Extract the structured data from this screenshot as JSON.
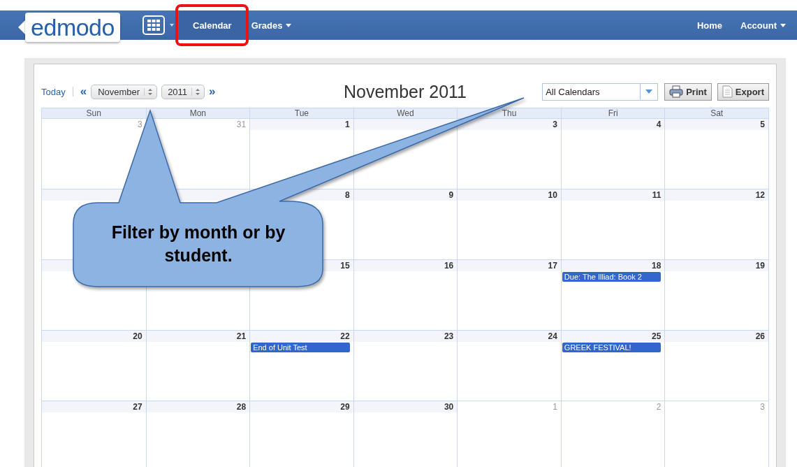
{
  "nav": {
    "logo": "edmodo",
    "items": [
      {
        "label": "Calendar",
        "selected": true,
        "has_menu": false,
        "highlighted": true
      },
      {
        "label": "Grades",
        "selected": false,
        "has_menu": true,
        "highlighted": false
      }
    ],
    "right_items": [
      {
        "label": "Home",
        "has_menu": false
      },
      {
        "label": "Account",
        "has_menu": true
      }
    ]
  },
  "toolbar": {
    "today": "Today",
    "prev": "«",
    "month": "November",
    "year": "2011",
    "next": "»",
    "title": "November 2011",
    "calendar_filter": "All Calendars",
    "buttons": [
      {
        "label": "Print",
        "kind": "print"
      },
      {
        "label": "Export",
        "kind": "export"
      }
    ]
  },
  "weekdays": [
    "Sun",
    "Mon",
    "Tue",
    "Wed",
    "Thu",
    "Fri",
    "Sat"
  ],
  "weeks": [
    [
      {
        "kind": "day",
        "number": "3",
        "current_month": false
      },
      {
        "kind": "day",
        "number": "31",
        "current_month": false
      },
      {
        "kind": "day",
        "number": "1",
        "current_month": true
      },
      {
        "kind": "day",
        "current_month": true
      },
      {
        "kind": "day",
        "number": "3",
        "current_month": true
      },
      {
        "kind": "day",
        "number": "4",
        "current_month": true
      },
      {
        "kind": "day",
        "number": "5",
        "current_month": true
      }
    ],
    [
      {
        "kind": "day",
        "current_month": true
      },
      {
        "kind": "day",
        "current_month": true
      },
      {
        "kind": "day",
        "number": "8",
        "current_month": true
      },
      {
        "kind": "day",
        "number": "9",
        "current_month": true
      },
      {
        "kind": "day",
        "number": "10",
        "current_month": true
      },
      {
        "kind": "day",
        "number": "11",
        "current_month": true
      },
      {
        "kind": "day",
        "number": "12",
        "current_month": true
      }
    ],
    [
      {
        "kind": "day",
        "current_month": true
      },
      {
        "kind": "covered"
      },
      {
        "kind": "day",
        "number": "15",
        "current_month": true
      },
      {
        "kind": "day",
        "number": "16",
        "current_month": true
      },
      {
        "kind": "day",
        "number": "17",
        "current_month": true
      },
      {
        "kind": "day",
        "number": "18",
        "current_month": true,
        "events": [
          "Due: The Illiad: Book 2"
        ]
      },
      {
        "kind": "day",
        "number": "19",
        "current_month": true
      }
    ],
    [
      {
        "kind": "day",
        "number": "20",
        "current_month": true
      },
      {
        "kind": "day",
        "number": "21",
        "current_month": true
      },
      {
        "kind": "day",
        "number": "22",
        "current_month": true,
        "events": [
          "End of Unit Test"
        ]
      },
      {
        "kind": "day",
        "number": "23",
        "current_month": true
      },
      {
        "kind": "day",
        "number": "24",
        "current_month": true
      },
      {
        "kind": "day",
        "number": "25",
        "current_month": true,
        "events": [
          "GREEK FESTIVAL!"
        ]
      },
      {
        "kind": "day",
        "number": "26",
        "current_month": true
      }
    ],
    [
      {
        "kind": "day",
        "number": "27",
        "current_month": true
      },
      {
        "kind": "day",
        "number": "28",
        "current_month": true
      },
      {
        "kind": "day",
        "number": "29",
        "current_month": true
      },
      {
        "kind": "day",
        "number": "30",
        "current_month": true
      },
      {
        "kind": "day",
        "number": "1",
        "current_month": false
      },
      {
        "kind": "day",
        "number": "2",
        "current_month": false
      },
      {
        "kind": "day",
        "number": "3",
        "current_month": false
      }
    ]
  ],
  "callout": {
    "text": "Filter by month or by student."
  }
}
